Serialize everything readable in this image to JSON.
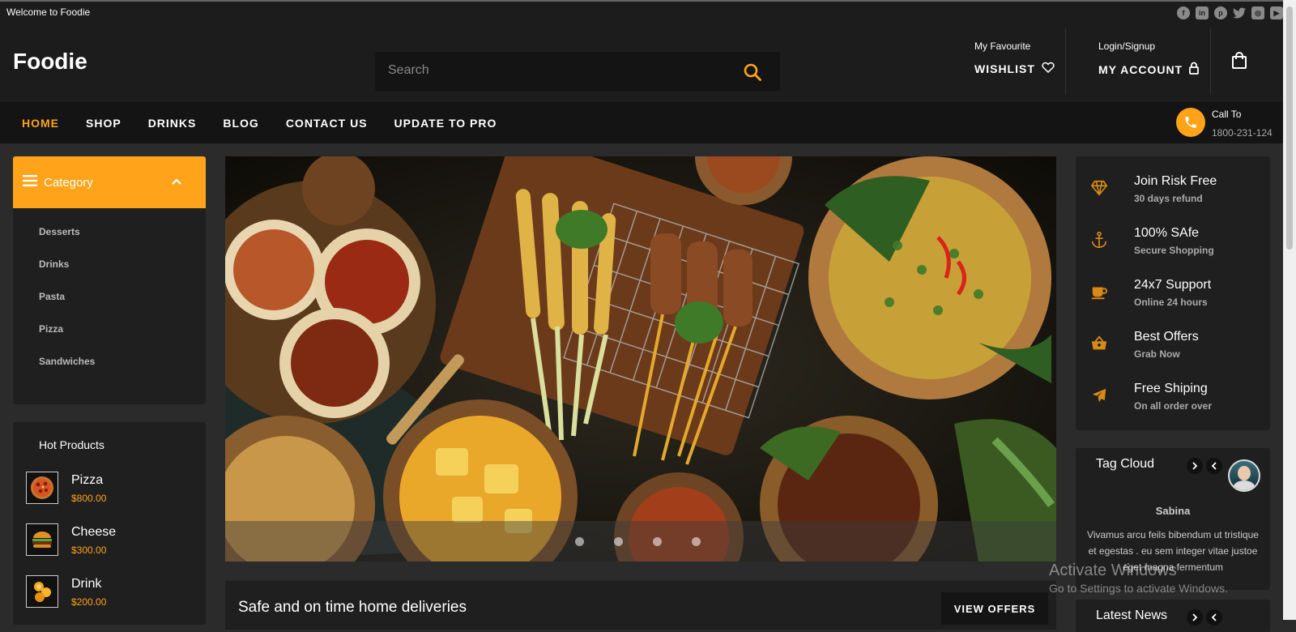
{
  "topbar": {
    "welcome": "Welcome to Foodie",
    "socials": [
      "facebook-icon",
      "linkedin-icon",
      "pinterest-icon",
      "twitter-icon",
      "instagram-icon",
      "youtube-icon"
    ]
  },
  "header": {
    "logo": "Foodie",
    "search_placeholder": "Search",
    "wishlist_small": "My Favourite",
    "wishlist_label": "WISHLIST",
    "account_small": "Login/Signup",
    "account_label": "MY ACCOUNT"
  },
  "nav": {
    "items": [
      {
        "label": "HOME",
        "active": true
      },
      {
        "label": "SHOP"
      },
      {
        "label": "DRINKS"
      },
      {
        "label": "BLOG"
      },
      {
        "label": "CONTACT US"
      },
      {
        "label": "UPDATE TO PRO"
      }
    ],
    "call_label": "Call To",
    "call_number": "1800-231-124"
  },
  "category": {
    "title": "Category",
    "items": [
      "Desserts",
      "Drinks",
      "Pasta",
      "Pizza",
      "Sandwiches"
    ]
  },
  "hot_products": {
    "title": "Hot Products",
    "items": [
      {
        "name": "Pizza",
        "price": "$800.00"
      },
      {
        "name": "Cheese",
        "price": "$300.00"
      },
      {
        "name": "Drink",
        "price": "$200.00"
      }
    ]
  },
  "banner": {
    "slide_count": 4,
    "active_slide": 1
  },
  "delivery": {
    "text": "Safe and on time home deliveries",
    "button": "VIEW OFFERS"
  },
  "features": [
    {
      "title": "Join Risk Free",
      "subtitle": "30 days refund",
      "icon": "diamond-icon"
    },
    {
      "title": "100% SAfe",
      "subtitle": "Secure Shopping",
      "icon": "anchor-icon"
    },
    {
      "title": "24x7 Support",
      "subtitle": "Online 24 hours",
      "icon": "coffee-cup-icon"
    },
    {
      "title": "Best Offers",
      "subtitle": "Grab Now",
      "icon": "basket-icon"
    },
    {
      "title": "Free Shiping",
      "subtitle": "On all order over",
      "icon": "plane-icon"
    }
  ],
  "tag_cloud": {
    "title": "Tag Cloud",
    "testimonial_name": "Sabina",
    "testimonial_text": "Vivamus arcu feils bibendum ut tristique et egestas . eu sem integer vitae justoe eget magna fermentum"
  },
  "latest_news": {
    "title": "Latest News"
  },
  "watermark": {
    "line1": "Activate Windows",
    "line2": "Go to Settings to activate Windows."
  },
  "colors": {
    "accent": "#ffa31a",
    "background": "#2b2b2b",
    "panel": "#1f1f1f"
  }
}
